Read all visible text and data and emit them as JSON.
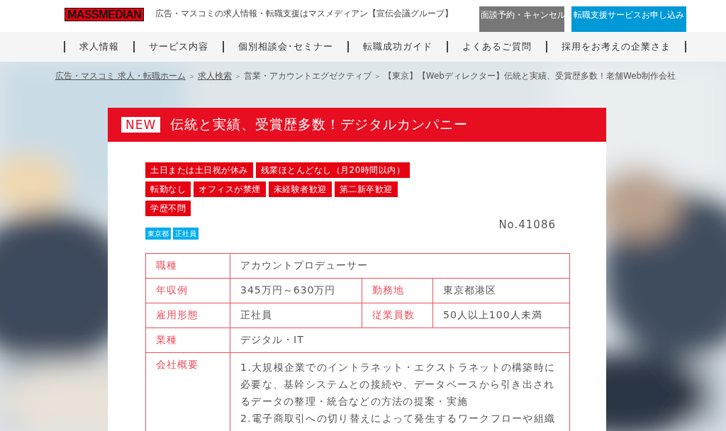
{
  "header": {
    "logo": "MASSMEDIAN",
    "tagline": "広告・マスコミの求人情報・転職支援はマスメディアン【宣伝会議グループ】",
    "buttons": [
      {
        "label": "面談予約・キャンセル",
        "kind": "secondary"
      },
      {
        "label": "転職支援サービスお申し込み",
        "kind": "primary"
      }
    ]
  },
  "nav": [
    "求人情報",
    "サービス内容",
    "個別相談会･セミナー",
    "転職成功ガイド",
    "よくあるご質問",
    "採用をお考えの企業さま"
  ],
  "breadcrumb": [
    {
      "label": "広告・マスコミ 求人・転職ホーム",
      "link": true
    },
    {
      "separator": "＞",
      "label": "求人検索",
      "link": true
    },
    {
      "separator": "＞",
      "label": "営業・アカウントエグゼクティブ",
      "link": false
    },
    {
      "separator": "＞",
      "label": "【東京】【Webディレクター】伝統と実績、受賞歴多数！老舗Web制作会社",
      "link": false
    }
  ],
  "job": {
    "badge": "NEW",
    "title": "伝統と実績、受賞歴多数！デジタルカンパニー",
    "features": [
      [
        "土日または土日祝が休み",
        "残業ほとんどなし（月20時間以内）"
      ],
      [
        "転勤なし",
        "オフィスが禁煙",
        "未経験者歓迎",
        "第二新卒歓迎"
      ],
      [
        "学歴不問"
      ]
    ],
    "tags": [
      "東京都",
      "正社員"
    ],
    "number": "No.41086",
    "rows": [
      {
        "cells": [
          {
            "label": "職種",
            "value": "アカウントプロデューサー"
          }
        ]
      },
      {
        "cells": [
          {
            "label": "年収例",
            "value": "345万円～630万円"
          },
          {
            "label": "勤務地",
            "value": "東京都港区"
          }
        ]
      },
      {
        "cells": [
          {
            "label": "雇用形態",
            "value": "正社員"
          },
          {
            "label": "従業員数",
            "value": "50人以上100人未満"
          }
        ]
      },
      {
        "cells": [
          {
            "label": "業種",
            "value": "デジタル・IT"
          }
        ]
      },
      {
        "cells": [
          {
            "label": "会社概要",
            "paragraphs": [
              "1.大規模企業でのイントラネット・エクストラネットの構築時に必要な、基幹システムとの接続や、データベースから引き出されるデータの整理・統合などの方法の提案・実施",
              "2.電子商取引への切り替えによって発生するワークフローや組織"
            ]
          }
        ]
      }
    ]
  }
}
